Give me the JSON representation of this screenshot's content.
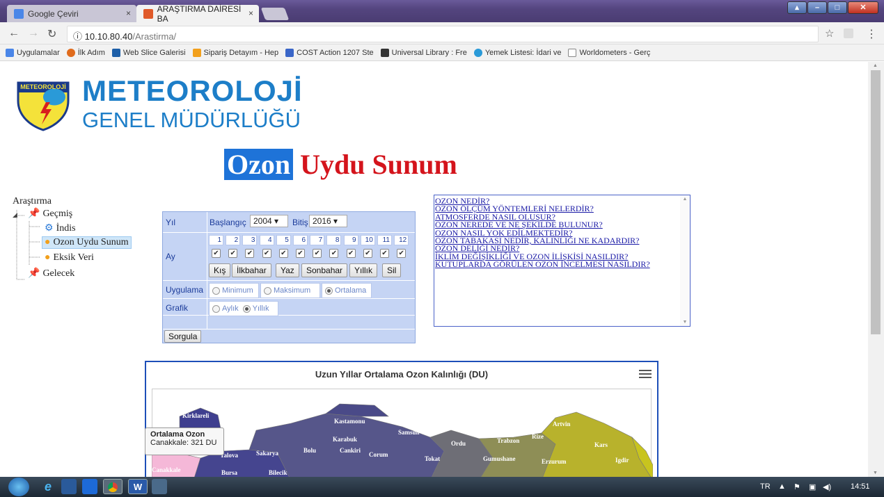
{
  "browser": {
    "tabs": [
      {
        "title": "Google Çeviri",
        "favicon_color": "#4a86e8"
      },
      {
        "title": "ARAŞTIRMA DAİRESİ BA",
        "favicon_color": "#e05a2a"
      }
    ],
    "close_glyph": "×",
    "url_host": "10.10.80.40",
    "url_path": "/Arastirma/",
    "url_icon": "ⓘ",
    "bookmarks": [
      {
        "label": "Uygulamalar",
        "icon": "apps-grid-icon",
        "color": "#4a86e8"
      },
      {
        "label": "İlk Adım",
        "icon": "firefox-icon",
        "color": "#e06b1c"
      },
      {
        "label": "Web Slice Galerisi",
        "icon": "web-slice-icon",
        "color": "#1d5fa8"
      },
      {
        "label": "Sipariş Detayım - Hep",
        "icon": "hb-icon",
        "color": "#f2a01c"
      },
      {
        "label": "COST Action 1207 Ste",
        "icon": "cost-icon",
        "color": "#3a66c8"
      },
      {
        "label": "Universal Library : Fre",
        "icon": "library-icon",
        "color": "#333333"
      },
      {
        "label": "Yemek Listesi: İdari ve",
        "icon": "ie-icon",
        "color": "#2a9ad8"
      },
      {
        "label": "Worldometers - Gerç",
        "icon": "page-icon",
        "color": "#888888"
      }
    ]
  },
  "header": {
    "logo_badge": "METEOROLOJİ",
    "org_line1": "METEOROLOJİ",
    "org_line2": "GENEL MÜDÜRLÜĞÜ"
  },
  "page_title": {
    "highlight": "Ozon",
    "rest": " Uydu Sunum"
  },
  "tree": {
    "root": "Araştırma",
    "items": [
      {
        "label": "Geçmiş",
        "icon": "pin-icon",
        "level": 1
      },
      {
        "label": "İndis",
        "icon": "gears-icon",
        "level": 2
      },
      {
        "label": "Ozon Uydu Sunum",
        "icon": "orbs-icon",
        "level": 2,
        "selected": true
      },
      {
        "label": "Eksik Veri",
        "icon": "orbs-icon",
        "level": 2
      },
      {
        "label": "Gelecek",
        "icon": "pin-icon",
        "level": 1
      }
    ]
  },
  "form": {
    "year_label": "Yıl",
    "start_label": "Başlangıç",
    "start_value": "2004",
    "end_label": "Bitiş",
    "end_value": "2016",
    "month_label": "Ay",
    "months": [
      "1",
      "2",
      "3",
      "4",
      "5",
      "6",
      "7",
      "8",
      "9",
      "10",
      "11",
      "12"
    ],
    "month_checked": [
      true,
      true,
      true,
      true,
      true,
      true,
      true,
      true,
      true,
      true,
      true,
      true
    ],
    "season_buttons": [
      "Kış",
      "İlkbahar",
      "Yaz",
      "Sonbahar",
      "Yıllık",
      "Sil"
    ],
    "application_label": "Uygulama",
    "application_options": [
      "Minimum",
      "Maksimum",
      "Ortalama"
    ],
    "application_selected": "Ortalama",
    "graph_label": "Grafik",
    "graph_options": [
      "Aylık",
      "Yıllık"
    ],
    "graph_selected": "Yıllık",
    "query_button": "Sorgula"
  },
  "links": [
    "OZON NEDİR?",
    "OZON ÖLÇÜM YÖNTEMLERİ NELERDİR?",
    "ATMOSFERDE NASIL OLUŞUR?",
    "OZON NEREDE VE NE ŞEKİLDE BULUNUR?",
    "OZON NASIL YOK EDİLMEKTEDİR?",
    "OZON TABAKASI NEDİR, KALINLIĞI NE KADARDIR?",
    "OZON DELİĞİ NEDİR?",
    "İKLİM DEĞİŞİKLİĞİ VE OZON İLİŞKİSİ NASILDIR?",
    "KUTUPLARDA GÖRÜLEN OZON İNCELMESİ NASILDIR?"
  ],
  "map": {
    "title": "Uzun Yıllar Ortalama Ozon Kalınlığı (DU)",
    "tooltip_title": "Ortalama Ozon",
    "tooltip_value": "Canakkale: 321 DU",
    "province_labels": [
      "Kirklareli",
      "Istanbul",
      "Yalova",
      "Sakarya",
      "Bursa",
      "Bilecik",
      "Canakkale",
      "Kastamonu",
      "Karabuk",
      "Bolu",
      "Cankiri",
      "Corum",
      "Samsun",
      "Ordu",
      "Tokat",
      "Trabzon",
      "Rize",
      "Artvin",
      "Gumushane",
      "Erzurum",
      "Kars",
      "Igdir"
    ],
    "colors": {
      "low": "#f5b8d8",
      "mid": "#3f3f8f",
      "high": "#c8c41e"
    }
  },
  "taskbar": {
    "lang": "TR",
    "time": "14:51"
  }
}
